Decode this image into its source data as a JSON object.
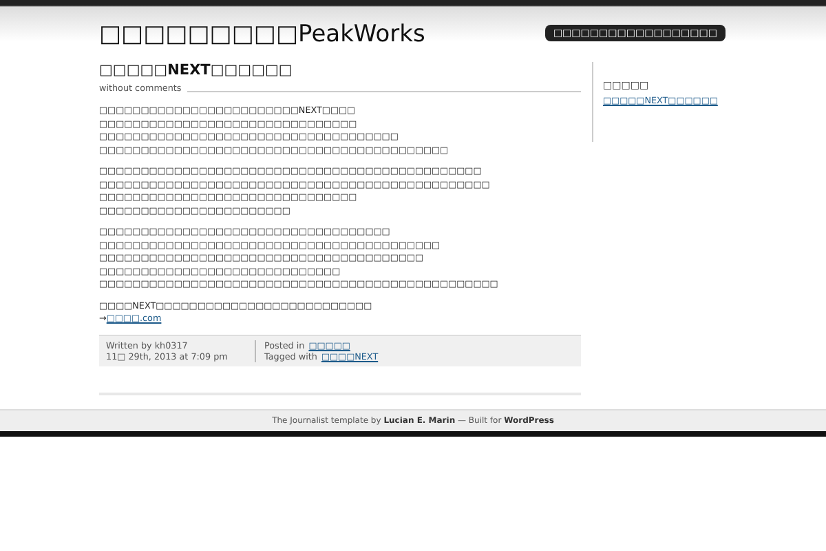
{
  "site": {
    "title": "□□□□□□□□□PeakWorks",
    "tagline": "□□□□□□□□□□□□□□□□□□"
  },
  "post": {
    "title": "□□□□□NEXT□□□□□□",
    "comments": "without comments",
    "paragraphs": [
      "□□□□□□□□□□□□□□□□□□□□□□□□NEXT□□□□\n□□□□□□□□□□□□□□□□□□□□□□□□□□□□□□□\n□□□□□□□□□□□□□□□□□□□□□□□□□□□□□□□□□□□□\n□□□□□□□□□□□□□□□□□□□□□□□□□□□□□□□□□□□□□□□□□□",
      "□□□□□□□□□□□□□□□□□□□□□□□□□□□□□□□□□□□□□□□□□□□□□□\n□□□□□□□□□□□□□□□□□□□□□□□□□□□□□□□□□□□□□□□□□□□□□□□\n□□□□□□□□□□□□□□□□□□□□□□□□□□□□□□□\n□□□□□□□□□□□□□□□□□□□□□□□",
      "□□□□□□□□□□□□□□□□□□□□□□□□□□□□□□□□□□□\n□□□□□□□□□□□□□□□□□□□□□□□□□□□□□□□□□□□□□□□□□\n□□□□□□□□□□□□□□□□□□□□□□□□□□□□□□□□□□□□□□□\n□□□□□□□□□□□□□□□□□□□□□□□□□□□□□\n□□□□□□□□□□□□□□□□□□□□□□□□□□□□□□□□□□□□□□□□□□□□□□□□",
      "□□□□NEXT□□□□□□□□□□□□□□□□□□□□□□□□□□"
    ],
    "source_arrow": "→",
    "source_link": "□□□□.com",
    "written_by": "Written by kh0317",
    "date": "11□ 29th, 2013 at 7:09 pm",
    "posted_in_label": "Posted in",
    "category": "□□□□□",
    "tagged_label": "Tagged with",
    "tag": "□□□□NEXT"
  },
  "sidebar": {
    "heading": "□□□□□",
    "links": [
      "□□□□□NEXT□□□□□□"
    ]
  },
  "footer": "The Journalist template by **Lucian E. Marin** — Built for **WordPress**"
}
